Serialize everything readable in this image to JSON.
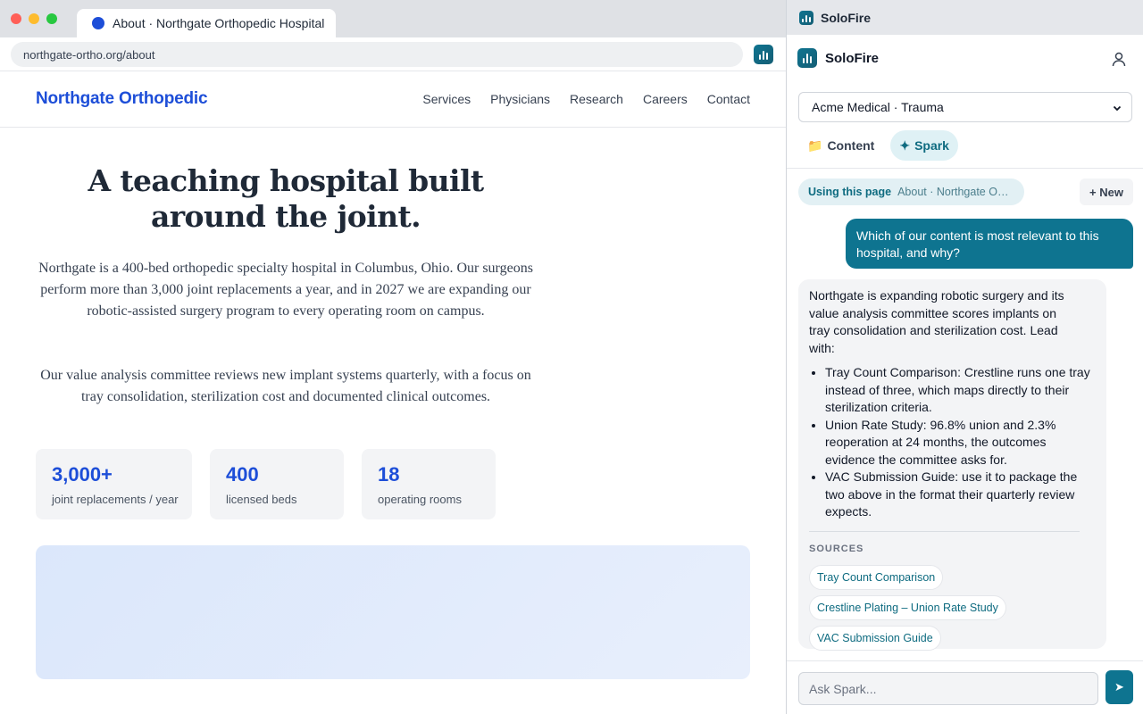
{
  "browser": {
    "tab_title": "About · Northgate Orthopedic Hospital",
    "url": "northgate-ortho.org/about"
  },
  "site": {
    "logo": "Northgate Orthopedic",
    "nav": [
      "Services",
      "Physicians",
      "Research",
      "Careers",
      "Contact"
    ],
    "hero_title": "A teaching hospital built around the joint.",
    "paragraph_1": "Northgate is a 400-bed orthopedic specialty hospital in Columbus, Ohio. Our surgeons perform more than 3,000 joint replacements a year, and in 2027 we are expanding our robotic-assisted surgery program to every operating room on campus.",
    "paragraph_2": "Our value analysis committee reviews new implant systems quarterly, with a focus on tray consolidation, sterilization cost and documented clinical outcomes.",
    "stats": [
      {
        "value": "3,000+",
        "label": "joint replacements / year"
      },
      {
        "value": "400",
        "label": "licensed beds"
      },
      {
        "value": "18",
        "label": "operating rooms"
      }
    ]
  },
  "panel": {
    "window_title": "SoloFire",
    "brand": "SoloFire",
    "org_select": "Acme Medical · Trauma",
    "tabs": [
      {
        "icon": "📁",
        "label": "Content"
      },
      {
        "icon": "✦",
        "label": "Spark"
      }
    ],
    "context_label": "Using this page",
    "context_title": "About · Northgate Orthopedic Hospital",
    "new_button": "+ New",
    "user_message": "Which of our content is most relevant to this hospital, and why?",
    "bot_intro": "Northgate is expanding robotic surgery and its value analysis committee scores implants on tray consolidation and sterilization cost. Lead with:",
    "bot_points": [
      "Tray Count Comparison: Crestline runs one tray instead of three, which maps directly to their sterilization criteria.",
      "Union Rate Study: 96.8% union and 2.3% reoperation at 24 months, the outcomes evidence the committee asks for.",
      "VAC Submission Guide: use it to package the two above in the format their quarterly review expects."
    ],
    "sources_label": "SOURCES",
    "sources": [
      "Tray Count Comparison",
      "Crestline Plating – Union Rate Study",
      "VAC Submission Guide"
    ],
    "composer_placeholder": "Ask Spark...",
    "send_icon": "➤"
  }
}
